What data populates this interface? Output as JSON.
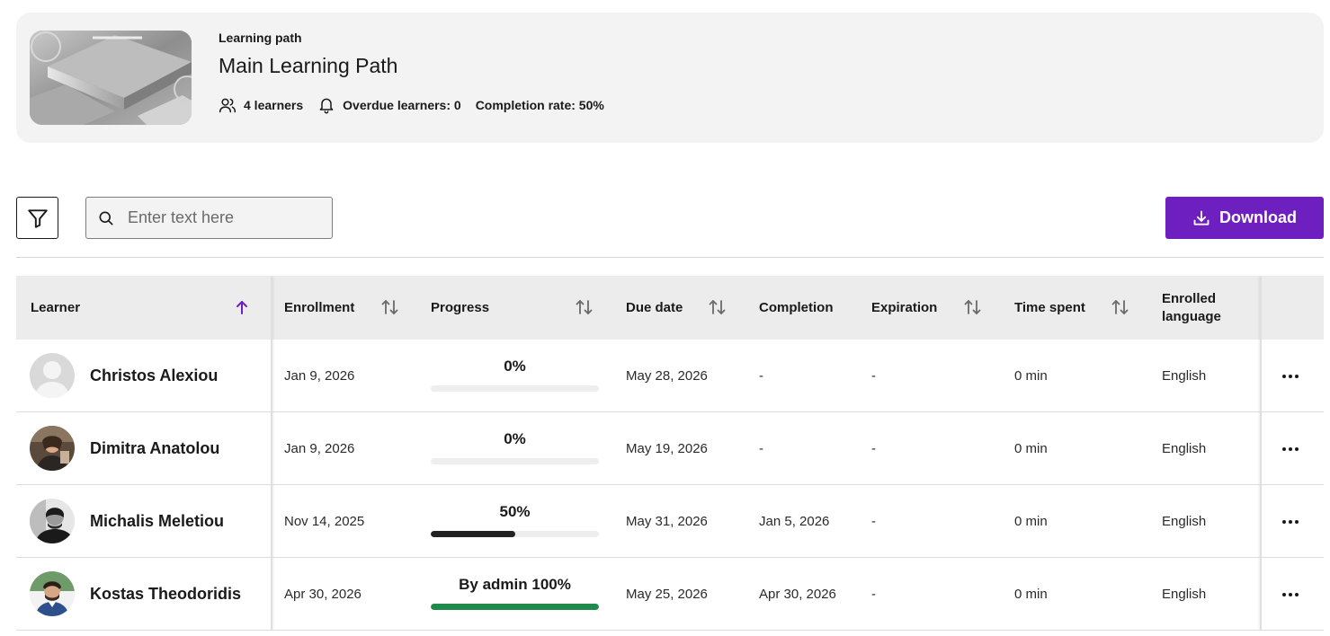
{
  "header": {
    "type_label": "Learning path",
    "title": "Main Learning Path",
    "learners": "4 learners",
    "overdue": "Overdue learners: 0",
    "completion_rate": "Completion rate: 50%"
  },
  "toolbar": {
    "search_placeholder": "Enter text here",
    "download_label": "Download"
  },
  "table": {
    "columns": [
      "Learner",
      "Enrollment",
      "Progress",
      "Due date",
      "Completion",
      "Expiration",
      "Time spent",
      "Enrolled language"
    ],
    "sort": {
      "active_column": "Learner",
      "direction": "ascending"
    },
    "rows": [
      {
        "name": "Christos Alexiou",
        "enrollment": "Jan 9, 2026",
        "progress_label": "0%",
        "progress_value": 0,
        "progress_color": "#222222",
        "due_date": "May 28, 2026",
        "completion": "-",
        "expiration": "-",
        "time_spent": "0 min",
        "language": "English"
      },
      {
        "name": "Dimitra Anatolou",
        "enrollment": "Jan 9, 2026",
        "progress_label": "0%",
        "progress_value": 0,
        "progress_color": "#222222",
        "due_date": "May 19, 2026",
        "completion": "-",
        "expiration": "-",
        "time_spent": "0 min",
        "language": "English"
      },
      {
        "name": "Michalis Meletiou",
        "enrollment": "Nov 14, 2025",
        "progress_label": "50%",
        "progress_value": 50,
        "progress_color": "#222222",
        "due_date": "May 31, 2026",
        "completion": "Jan 5, 2026",
        "expiration": "-",
        "time_spent": "0 min",
        "language": "English"
      },
      {
        "name": "Kostas Theodoridis",
        "enrollment": "Apr 30, 2026",
        "progress_label": "By admin 100%",
        "progress_value": 100,
        "progress_color": "#1f8a4c",
        "due_date": "May 25, 2026",
        "completion": "Apr 30, 2026",
        "expiration": "-",
        "time_spent": "0 min",
        "language": "English"
      }
    ]
  },
  "icons": {
    "filter": "filter-icon",
    "search": "search-icon",
    "download": "download-icon",
    "learners": "users-icon",
    "overdue": "bell-icon",
    "sort_asc": "arrow-up-icon",
    "sort": "sort-icon",
    "row_menu": "more-horizontal-icon"
  },
  "colors": {
    "accent": "#6e1fbf",
    "header_bg": "#f3f3f3",
    "table_header_bg": "#ececec",
    "complete_bar": "#1f8a4c"
  }
}
